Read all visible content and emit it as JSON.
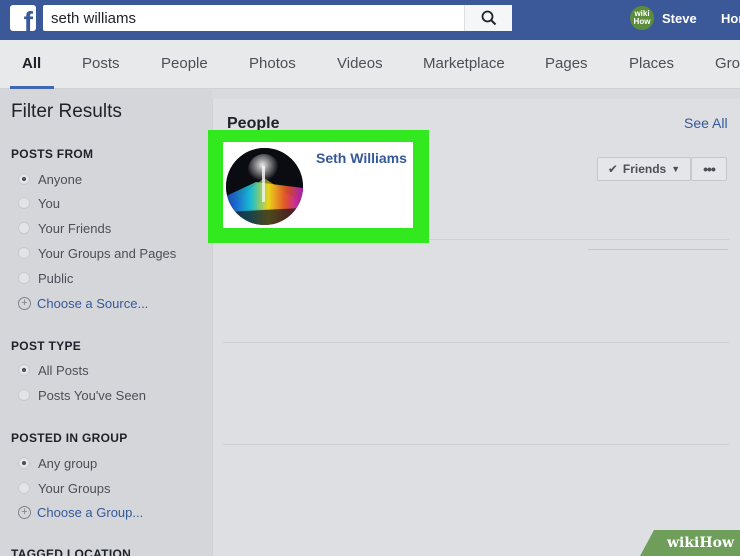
{
  "header": {
    "logo_letter": "f",
    "search_value": "seth williams",
    "user_name": "Steve",
    "avatar_text": "wiki How",
    "home_label": "Home"
  },
  "tabs": [
    "All",
    "Posts",
    "People",
    "Photos",
    "Videos",
    "Marketplace",
    "Pages",
    "Places",
    "Groups"
  ],
  "sidebar": {
    "title": "Filter Results",
    "posts_from": {
      "header": "POSTS FROM",
      "options": [
        "Anyone",
        "You",
        "Your Friends",
        "Your Groups and Pages",
        "Public"
      ],
      "link": "Choose a Source..."
    },
    "post_type": {
      "header": "POST TYPE",
      "options": [
        "All Posts",
        "Posts You've Seen"
      ]
    },
    "posted_in_group": {
      "header": "POSTED IN GROUP",
      "options": [
        "Any group",
        "Your Groups"
      ],
      "link": "Choose a Group..."
    },
    "tagged_location": {
      "header": "TAGGED LOCATION"
    }
  },
  "main": {
    "section_title": "People",
    "see_all": "See All",
    "result": {
      "name": "Seth Williams",
      "friends_label": "Friends",
      "more_label": "•••"
    }
  },
  "watermark": "wikiHow",
  "colors": {
    "brand": "#3b5998",
    "highlight": "#32e81e",
    "link": "#365899"
  }
}
